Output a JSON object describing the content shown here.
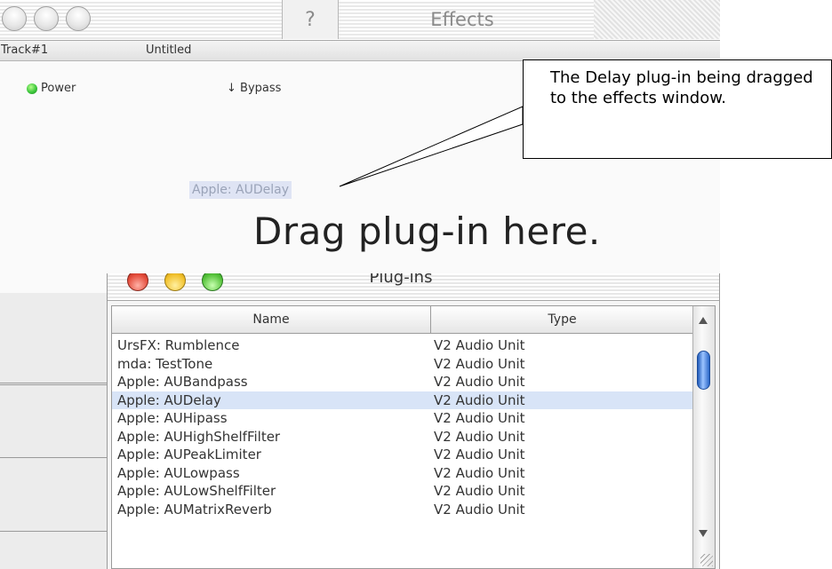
{
  "effects_window": {
    "title": "Effects",
    "help_label": "?",
    "track_id": "Track#1",
    "track_name": "Untitled",
    "power_label": "Power",
    "bypass_label": "↓ Bypass",
    "dragged_item": "Apple: AUDelay",
    "drop_hint": "Drag plug-in here."
  },
  "callout_text": "The Delay plug-in being dragged to the effects window.",
  "plugins_window": {
    "title": "Plug-ins",
    "columns": {
      "name": "Name",
      "type": "Type"
    },
    "selected_index": 3,
    "rows": [
      {
        "name": "UrsFX: Rumblence",
        "type": "V2 Audio Unit"
      },
      {
        "name": "mda: TestTone",
        "type": "V2 Audio Unit"
      },
      {
        "name": "Apple: AUBandpass",
        "type": "V2 Audio Unit"
      },
      {
        "name": "Apple: AUDelay",
        "type": "V2 Audio Unit"
      },
      {
        "name": "Apple: AUHipass",
        "type": "V2 Audio Unit"
      },
      {
        "name": "Apple: AUHighShelfFilter",
        "type": "V2 Audio Unit"
      },
      {
        "name": "Apple: AUPeakLimiter",
        "type": "V2 Audio Unit"
      },
      {
        "name": "Apple: AULowpass",
        "type": "V2 Audio Unit"
      },
      {
        "name": "Apple: AULowShelfFilter",
        "type": "V2 Audio Unit"
      },
      {
        "name": "Apple: AUMatrixReverb",
        "type": "V2 Audio Unit"
      }
    ]
  }
}
